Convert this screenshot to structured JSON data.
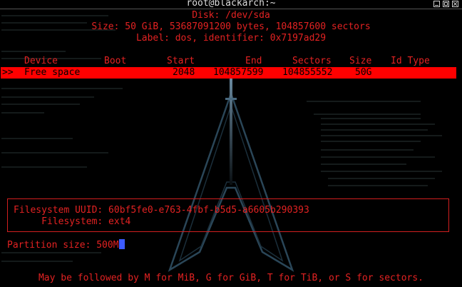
{
  "window": {
    "title": "root@blackarch:~"
  },
  "disk": {
    "name_line": "Disk: /dev/sda",
    "size_line": "Size: 50 GiB, 53687091200 bytes, 104857600 sectors",
    "label_line": "Label: dos, identifier: 0x7197ad29"
  },
  "table": {
    "headers": [
      "Device",
      "Boot",
      "Start",
      "End",
      "Sectors",
      "Size",
      "Id Type"
    ],
    "selected_row": {
      "marker": ">>",
      "device": "Free space",
      "boot": "",
      "start": "2048",
      "end": "104857599",
      "sectors": "104855552",
      "size": "50G",
      "id_type": ""
    }
  },
  "info": {
    "fs_uuid_line": "Filesystem UUID: 60bf5fe0-e763-4fbf-b5d5-a6605b290393",
    "fs_type_line": "     Filesystem: ext4"
  },
  "prompt": {
    "label": "Partition size: ",
    "value": "500M"
  },
  "hint": "May be followed by M for MiB, G for GiB, T for TiB, or S for sectors.",
  "colors": {
    "accent_red": "#e32222",
    "highlight_red": "#ff0000",
    "cursor_blue": "#3d5bff",
    "background": "#000000"
  }
}
